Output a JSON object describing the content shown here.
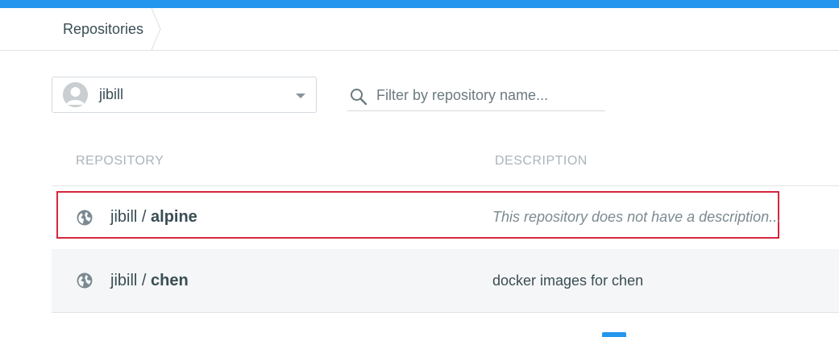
{
  "colors": {
    "accent": "#2496ed",
    "highlight": "#d7263d",
    "text": "#394d54",
    "muted": "#a9b4ba"
  },
  "breadcrumb": {
    "items": [
      {
        "label": "Repositories"
      }
    ]
  },
  "namespace": {
    "selected": "jibill",
    "icon": "avatar-placeholder"
  },
  "filter": {
    "placeholder": "Filter by repository name...",
    "value": "",
    "icon": "search-icon"
  },
  "table": {
    "columns": [
      "REPOSITORY",
      "DESCRIPTION"
    ],
    "rows": [
      {
        "namespace": "jibill",
        "separator": " / ",
        "name": "alpine",
        "description": "This repository does not have a description...",
        "visibility_icon": "globe-icon",
        "highlighted": true
      },
      {
        "namespace": "jibill",
        "separator": " / ",
        "name": "chen",
        "description": "docker images for chen",
        "visibility_icon": "globe-icon",
        "highlighted": false
      }
    ]
  }
}
